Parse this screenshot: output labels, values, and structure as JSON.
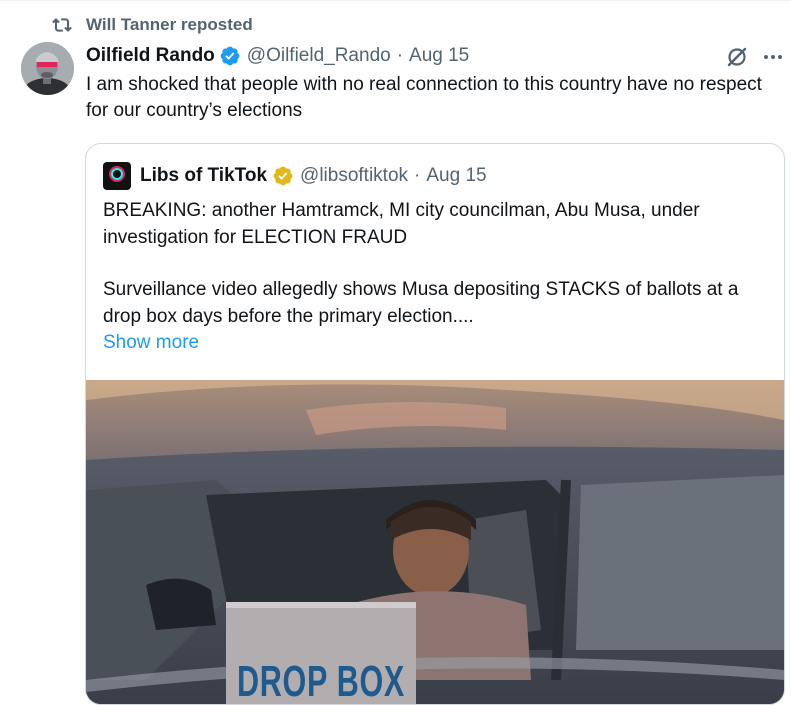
{
  "repost": {
    "text": "Will Tanner reposted",
    "icon": "repost-icon"
  },
  "tweet": {
    "author_name": "Oilfield Rando",
    "handle": "@Oilfield_Rando",
    "separator": "·",
    "date": "Aug 15",
    "verified_color": "#1d9bf0",
    "text": "I am shocked that people with no real connection to this country have no respect for our country’s elections"
  },
  "quote": {
    "author_name": "Libs of TikTok",
    "handle": "@libsoftiktok",
    "separator": "·",
    "date": "Aug 15",
    "verified_color": "#e2b719",
    "paragraph1": "BREAKING: another Hamtramck, MI city councilman, Abu Musa, under investigation for ELECTION FRAUD",
    "paragraph2": "Surveillance video allegedly shows Musa depositing STACKS of ballots at a drop box days before the primary election....",
    "show_more": "Show more",
    "media": {
      "sign_text": "DROP BOX"
    }
  },
  "colors": {
    "link": "#1d9bf0",
    "secondary_text": "#536471",
    "border": "#cfd9de"
  }
}
